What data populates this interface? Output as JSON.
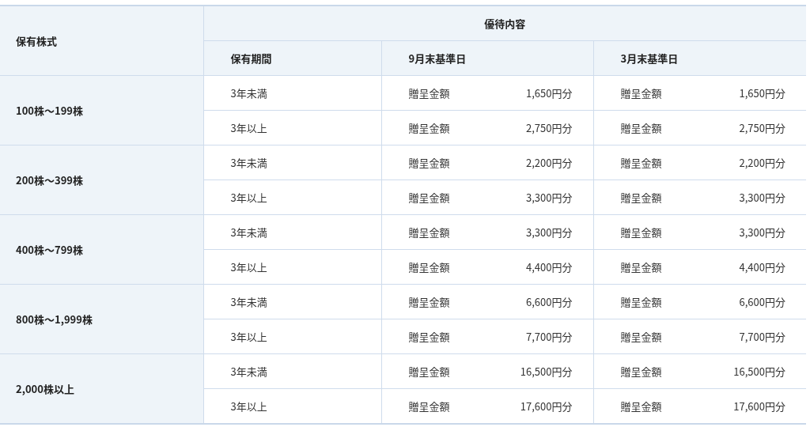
{
  "header": {
    "shares": "保有株式",
    "benefits": "優待内容",
    "period": "保有期間",
    "columns": [
      "9月末基準日",
      "3月末基準日"
    ]
  },
  "tiers": [
    {
      "shares": "100株～199株",
      "rows": [
        {
          "period": "3年未満",
          "cells": [
            {
              "label": "贈呈金額",
              "amount": "1,650円分"
            },
            {
              "label": "贈呈金額",
              "amount": "1,650円分"
            }
          ]
        },
        {
          "period": "3年以上",
          "cells": [
            {
              "label": "贈呈金額",
              "amount": "2,750円分"
            },
            {
              "label": "贈呈金額",
              "amount": "2,750円分"
            }
          ]
        }
      ]
    },
    {
      "shares": "200株～399株",
      "rows": [
        {
          "period": "3年未満",
          "cells": [
            {
              "label": "贈呈金額",
              "amount": "2,200円分"
            },
            {
              "label": "贈呈金額",
              "amount": "2,200円分"
            }
          ]
        },
        {
          "period": "3年以上",
          "cells": [
            {
              "label": "贈呈金額",
              "amount": "3,300円分"
            },
            {
              "label": "贈呈金額",
              "amount": "3,300円分"
            }
          ]
        }
      ]
    },
    {
      "shares": "400株～799株",
      "rows": [
        {
          "period": "3年未満",
          "cells": [
            {
              "label": "贈呈金額",
              "amount": "3,300円分"
            },
            {
              "label": "贈呈金額",
              "amount": "3,300円分"
            }
          ]
        },
        {
          "period": "3年以上",
          "cells": [
            {
              "label": "贈呈金額",
              "amount": "4,400円分"
            },
            {
              "label": "贈呈金額",
              "amount": "4,400円分"
            }
          ]
        }
      ]
    },
    {
      "shares": "800株～1,999株",
      "rows": [
        {
          "period": "3年未満",
          "cells": [
            {
              "label": "贈呈金額",
              "amount": "6,600円分"
            },
            {
              "label": "贈呈金額",
              "amount": "6,600円分"
            }
          ]
        },
        {
          "period": "3年以上",
          "cells": [
            {
              "label": "贈呈金額",
              "amount": "7,700円分"
            },
            {
              "label": "贈呈金額",
              "amount": "7,700円分"
            }
          ]
        }
      ]
    },
    {
      "shares": "2,000株以上",
      "rows": [
        {
          "period": "3年未満",
          "cells": [
            {
              "label": "贈呈金額",
              "amount": "16,500円分"
            },
            {
              "label": "贈呈金額",
              "amount": "16,500円分"
            }
          ]
        },
        {
          "period": "3年以上",
          "cells": [
            {
              "label": "贈呈金額",
              "amount": "17,600円分"
            },
            {
              "label": "贈呈金額",
              "amount": "17,600円分"
            }
          ]
        }
      ]
    }
  ]
}
